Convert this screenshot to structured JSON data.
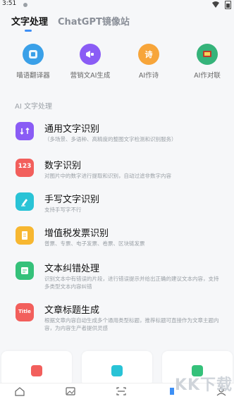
{
  "status": {
    "time": "3:51"
  },
  "tabs": [
    {
      "label": "文字处理"
    },
    {
      "label": "ChatGPT镜像站"
    }
  ],
  "quick_tools": [
    {
      "label": "喵语翻译器",
      "glyph": "",
      "color": "#3aa0e8",
      "icon": "translate-icon"
    },
    {
      "label": "营销文AI生成",
      "glyph": "",
      "color": "#8a5cf5",
      "icon": "megaphone-icon"
    },
    {
      "label": "AI作诗",
      "glyph": "诗",
      "color": "#f7a53a",
      "icon": "poem-icon"
    },
    {
      "label": "AI作对联",
      "glyph": "",
      "color": "#35b37a",
      "icon": "couplet-icon"
    }
  ],
  "section_label": "AI 文字处理",
  "features": [
    {
      "title": "通用文字识别",
      "desc": "（多场景、多语种、高精度的整图文字检测和识别服务）",
      "color": "#8a5cf5",
      "glyph": "",
      "icon": "text-recognition-icon"
    },
    {
      "title": "数字识别",
      "desc": "对图片中的数字进行提取和识别，自动过滤非数字内容",
      "color": "#f25f5c",
      "glyph": "123",
      "icon": "number-icon"
    },
    {
      "title": "手写文字识别",
      "desc": "支持手写字不行",
      "color": "#29c3d6",
      "glyph": "",
      "icon": "handwriting-icon"
    },
    {
      "title": "增值税发票识别",
      "desc": "普票、专票、电子发票、卷票、区块链发票",
      "color": "#f7b731",
      "glyph": "",
      "icon": "invoice-icon"
    },
    {
      "title": "文本纠错处理",
      "desc": "识别文本中有错误的片段，进行错误提示并给出正确的建议文本内容，支持多类型文本内容纠错",
      "color": "#35c17a",
      "glyph": "",
      "icon": "correction-icon"
    },
    {
      "title": "文章标题生成",
      "desc": "根据文章内容自动生成多个通用类型标题，推荐标题可直接作为文章主题内容，为内容生产者提供灵感",
      "color": "#f25f5c",
      "glyph": "Title",
      "icon": "title-icon"
    }
  ],
  "watermark": "KK下载"
}
